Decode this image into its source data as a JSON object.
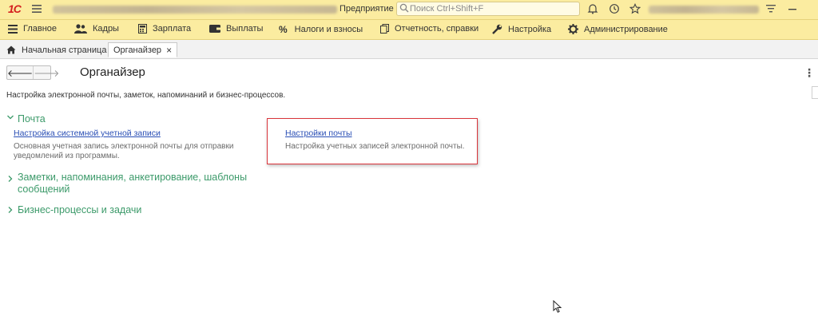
{
  "titlebar": {
    "app_suffix": "Предприятие",
    "search_placeholder": "Поиск Ctrl+Shift+F"
  },
  "mainmenu": {
    "items": [
      {
        "label": "Главное",
        "icon": "menu-icon"
      },
      {
        "label": "Кадры",
        "icon": "people-icon"
      },
      {
        "label": "Зарплата",
        "icon": "calculator-icon"
      },
      {
        "label": "Выплаты",
        "icon": "wallet-icon"
      },
      {
        "label": "Налоги и взносы",
        "icon": "percent-icon"
      },
      {
        "label": "Отчетность, справки",
        "icon": "documents-icon"
      },
      {
        "label": "Настройка",
        "icon": "wrench-icon"
      },
      {
        "label": "Администрирование",
        "icon": "gear-icon"
      }
    ]
  },
  "tabs": {
    "home": "Начальная страница",
    "active": "Органайзер",
    "close": "×"
  },
  "page": {
    "back": "🡐",
    "forward": "🡒",
    "title": "Органайзер",
    "more": "⋮",
    "description": "Настройка электронной почты, заметок, напоминаний и бизнес-процессов."
  },
  "groups": {
    "mail": {
      "title": "Почта",
      "expanded": true,
      "system_account_link": "Настройка системной учетной записи",
      "system_account_note_1": "Основная учетная запись электронной почты для отправки",
      "system_account_note_2": "уведомлений из программы.",
      "mail_settings_link": "Настройки почты",
      "mail_settings_note": "Настройка учетных записей электронной почты."
    },
    "notes": {
      "title_1": "Заметки, напоминания, анкетирование, шаблоны",
      "title_2": "сообщений",
      "expanded": false
    },
    "bp": {
      "title": "Бизнес-процессы и задачи",
      "expanded": false
    }
  },
  "colors": {
    "panel_bg": "#fbeca0",
    "group_green": "#3c9a6a",
    "link_blue": "#2a4fb5",
    "highlight_red": "#d9343a"
  }
}
